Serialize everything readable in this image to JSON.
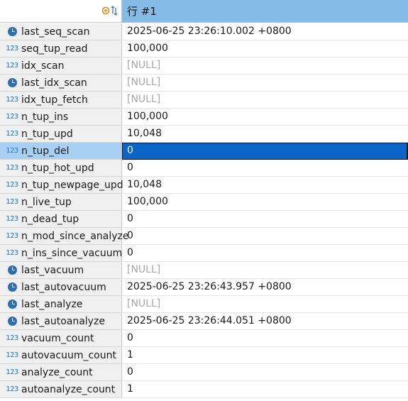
{
  "header": {
    "column_label": "行 #1"
  },
  "rows": [
    {
      "name": "last_seq_scan",
      "type": "clock",
      "value": "2025-06-25 23:26:10.002 +0800",
      "null": false
    },
    {
      "name": "seq_tup_read",
      "type": "num",
      "value": "100,000",
      "null": false
    },
    {
      "name": "idx_scan",
      "type": "num",
      "value": "[NULL]",
      "null": true
    },
    {
      "name": "last_idx_scan",
      "type": "clock",
      "value": "[NULL]",
      "null": true
    },
    {
      "name": "idx_tup_fetch",
      "type": "num",
      "value": "[NULL]",
      "null": true
    },
    {
      "name": "n_tup_ins",
      "type": "num",
      "value": "100,000",
      "null": false
    },
    {
      "name": "n_tup_upd",
      "type": "num",
      "value": "10,048",
      "null": false
    },
    {
      "name": "n_tup_del",
      "type": "num",
      "value": "0",
      "null": false,
      "selected": true
    },
    {
      "name": "n_tup_hot_upd",
      "type": "num",
      "value": "0",
      "null": false
    },
    {
      "name": "n_tup_newpage_upd",
      "type": "num",
      "value": "10,048",
      "null": false
    },
    {
      "name": "n_live_tup",
      "type": "num",
      "value": "100,000",
      "null": false
    },
    {
      "name": "n_dead_tup",
      "type": "num",
      "value": "0",
      "null": false
    },
    {
      "name": "n_mod_since_analyze",
      "type": "num",
      "value": "0",
      "null": false
    },
    {
      "name": "n_ins_since_vacuum",
      "type": "num",
      "value": "0",
      "null": false
    },
    {
      "name": "last_vacuum",
      "type": "clock",
      "value": "[NULL]",
      "null": true
    },
    {
      "name": "last_autovacuum",
      "type": "clock",
      "value": "2025-06-25 23:26:43.957 +0800",
      "null": false
    },
    {
      "name": "last_analyze",
      "type": "clock",
      "value": "[NULL]",
      "null": true
    },
    {
      "name": "last_autoanalyze",
      "type": "clock",
      "value": "2025-06-25 23:26:44.051 +0800",
      "null": false
    },
    {
      "name": "vacuum_count",
      "type": "num",
      "value": "0",
      "null": false
    },
    {
      "name": "autovacuum_count",
      "type": "num",
      "value": "1",
      "null": false
    },
    {
      "name": "analyze_count",
      "type": "num",
      "value": "0",
      "null": false
    },
    {
      "name": "autoanalyze_count",
      "type": "num",
      "value": "1",
      "null": false
    }
  ],
  "icons": {
    "num_glyph": "123"
  },
  "colors": {
    "header_bg": "#85bbe7",
    "selected_bg": "#0b64c8",
    "null_text": "#a8a8a8"
  }
}
